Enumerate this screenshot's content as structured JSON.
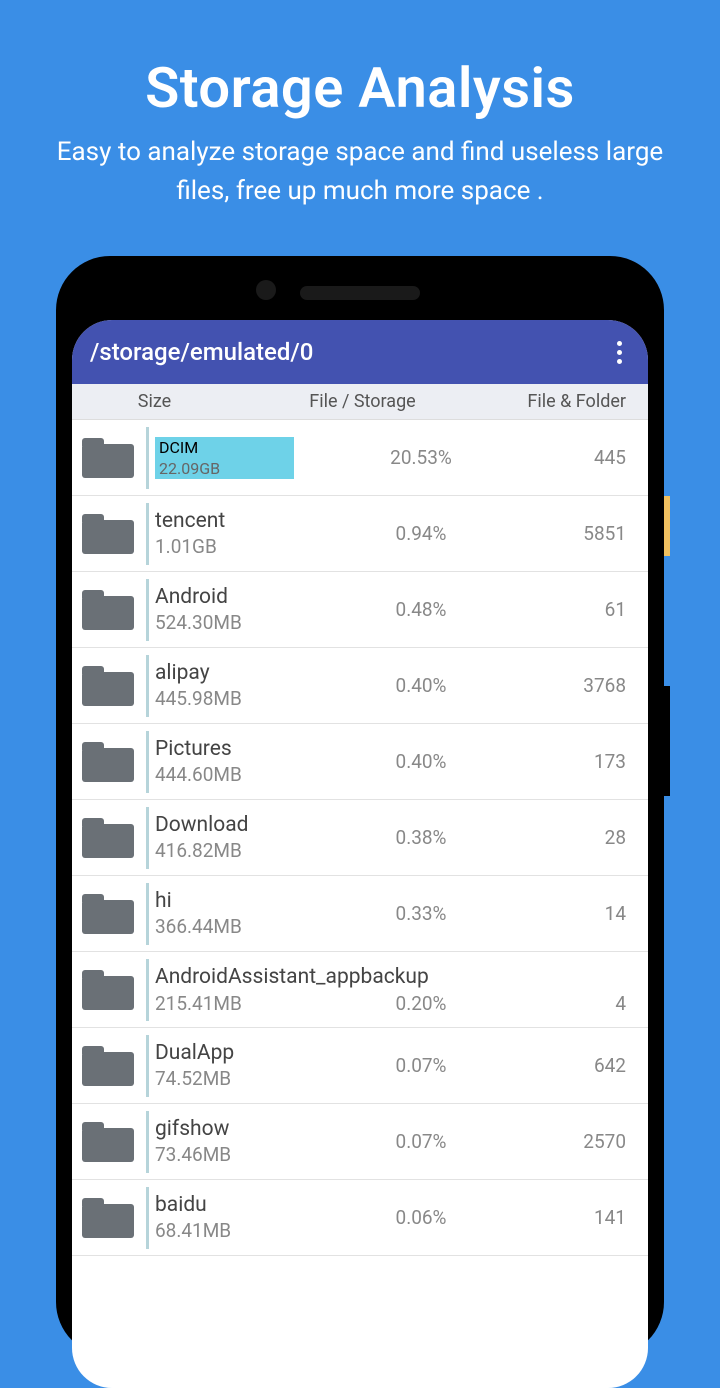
{
  "promo": {
    "title": "Storage Analysis",
    "subtitle": "Easy to analyze storage space and find useless large files, free up much more space ."
  },
  "appbar": {
    "path": "/storage/emulated/0"
  },
  "columns": {
    "size": "Size",
    "ratio": "File / Storage",
    "count": "File & Folder"
  },
  "files": [
    {
      "name": "DCIM",
      "size": "22.09GB",
      "pct": "20.53%",
      "count": "445",
      "highlighted": true
    },
    {
      "name": "tencent",
      "size": "1.01GB",
      "pct": "0.94%",
      "count": "5851"
    },
    {
      "name": "Android",
      "size": "524.30MB",
      "pct": "0.48%",
      "count": "61"
    },
    {
      "name": "alipay",
      "size": "445.98MB",
      "pct": "0.40%",
      "count": "3768"
    },
    {
      "name": "Pictures",
      "size": "444.60MB",
      "pct": "0.40%",
      "count": "173"
    },
    {
      "name": "Download",
      "size": "416.82MB",
      "pct": "0.38%",
      "count": "28"
    },
    {
      "name": "hi",
      "size": "366.44MB",
      "pct": "0.33%",
      "count": "14"
    },
    {
      "name": "AndroidAssistant_appbackup",
      "size": "215.41MB",
      "pct": "0.20%",
      "count": "4",
      "long": true
    },
    {
      "name": "DualApp",
      "size": "74.52MB",
      "pct": "0.07%",
      "count": "642"
    },
    {
      "name": "gifshow",
      "size": "73.46MB",
      "pct": "0.07%",
      "count": "2570"
    },
    {
      "name": "baidu",
      "size": "68.41MB",
      "pct": "0.06%",
      "count": "141"
    }
  ]
}
